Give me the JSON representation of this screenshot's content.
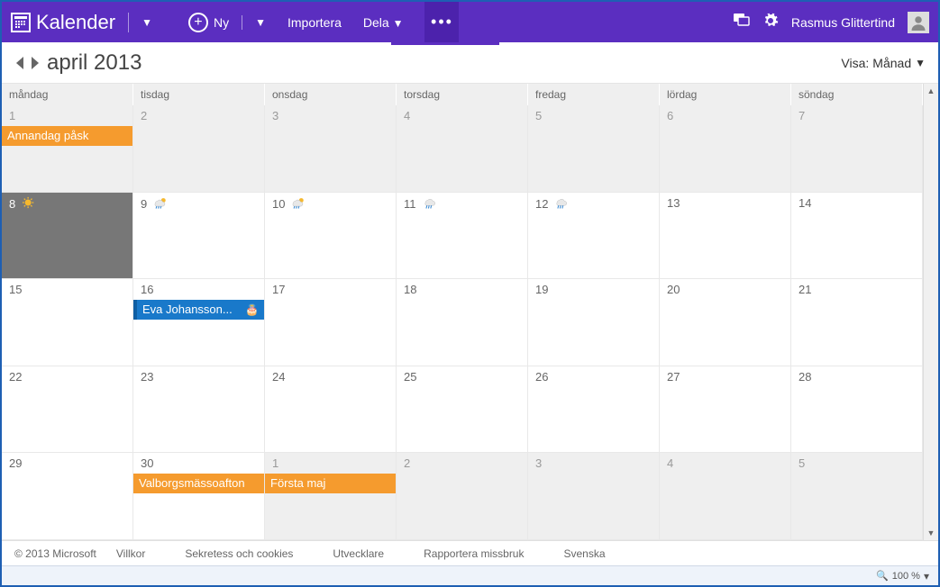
{
  "brand": {
    "name": "Kalender"
  },
  "top": {
    "new_label": "Ny",
    "import_label": "Importera",
    "share_label": "Dela",
    "user_name": "Rasmus Glittertind"
  },
  "subhead": {
    "month_title": "april 2013",
    "view_prefix": "Visa:",
    "view_value": "Månad"
  },
  "weekdays": [
    "måndag",
    "tisdag",
    "onsdag",
    "torsdag",
    "fredag",
    "lördag",
    "söndag"
  ],
  "weeks": [
    [
      {
        "n": "1",
        "other": true,
        "events": [
          {
            "label": "Annandag påsk",
            "cls": "ev-orange"
          }
        ]
      },
      {
        "n": "2",
        "other": true
      },
      {
        "n": "3",
        "other": true
      },
      {
        "n": "4",
        "other": true
      },
      {
        "n": "5",
        "other": true
      },
      {
        "n": "6",
        "other": true
      },
      {
        "n": "7",
        "other": true
      }
    ],
    [
      {
        "n": "8",
        "today": true,
        "weather": "sun"
      },
      {
        "n": "9",
        "weather": "sunrain"
      },
      {
        "n": "10",
        "weather": "sunrain"
      },
      {
        "n": "11",
        "weather": "rain"
      },
      {
        "n": "12",
        "weather": "rain"
      },
      {
        "n": "13"
      },
      {
        "n": "14"
      }
    ],
    [
      {
        "n": "15"
      },
      {
        "n": "16",
        "events": [
          {
            "label": "Eva Johansson...",
            "cls": "ev-blue",
            "cake": true
          }
        ]
      },
      {
        "n": "17"
      },
      {
        "n": "18"
      },
      {
        "n": "19"
      },
      {
        "n": "20"
      },
      {
        "n": "21"
      }
    ],
    [
      {
        "n": "22"
      },
      {
        "n": "23"
      },
      {
        "n": "24"
      },
      {
        "n": "25"
      },
      {
        "n": "26"
      },
      {
        "n": "27"
      },
      {
        "n": "28"
      }
    ],
    [
      {
        "n": "29"
      },
      {
        "n": "30",
        "events": [
          {
            "label": "Valborgsmässoafton",
            "cls": "ev-orange"
          }
        ]
      },
      {
        "n": "1",
        "other": true,
        "events": [
          {
            "label": "Första maj",
            "cls": "ev-orange"
          }
        ]
      },
      {
        "n": "2",
        "other": true
      },
      {
        "n": "3",
        "other": true
      },
      {
        "n": "4",
        "other": true
      },
      {
        "n": "5",
        "other": true
      }
    ]
  ],
  "footer": {
    "copyright": "© 2013 Microsoft",
    "links": [
      "Villkor",
      "Sekretess och cookies",
      "Utvecklare",
      "Rapportera missbruk",
      "Svenska"
    ]
  },
  "status": {
    "zoom": "100 %"
  }
}
